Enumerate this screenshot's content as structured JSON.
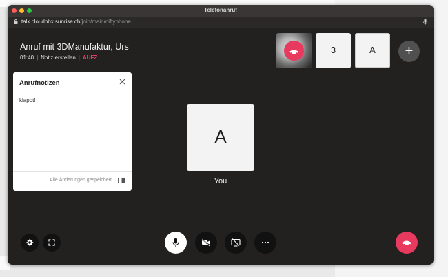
{
  "window": {
    "title": "Telefonanruf"
  },
  "browser": {
    "url_host": "talk.cloudpbx.sunrise.ch",
    "url_path": "/join/main/niftyphone"
  },
  "call": {
    "title": "Anruf mit 3DManufaktur, Urs",
    "duration": "01:40",
    "note_link": "Notiz erstellen",
    "recording": "AUFZ"
  },
  "participants": {
    "thumb_3_label": "3",
    "thumb_a_label": "A"
  },
  "notes": {
    "title": "Anrufnotizen",
    "text": "klappt!",
    "saved_status": "Alle Änderungen gespeichert"
  },
  "self": {
    "letter": "A",
    "name": "You"
  },
  "icons": {
    "lock": "lock-icon",
    "mic": "microphone-icon",
    "add": "plus-icon",
    "close": "close-icon",
    "panel": "side-panel-icon",
    "settings": "gear-icon",
    "fullscreen": "fullscreen-icon",
    "video_off": "video-off-icon",
    "screen_share_off": "screen-share-off-icon",
    "more": "more-dots-icon",
    "hangup": "phone-hangup-icon"
  },
  "colors": {
    "hangup": "#e83a5e",
    "recording": "#e5405f",
    "background": "#232020"
  }
}
